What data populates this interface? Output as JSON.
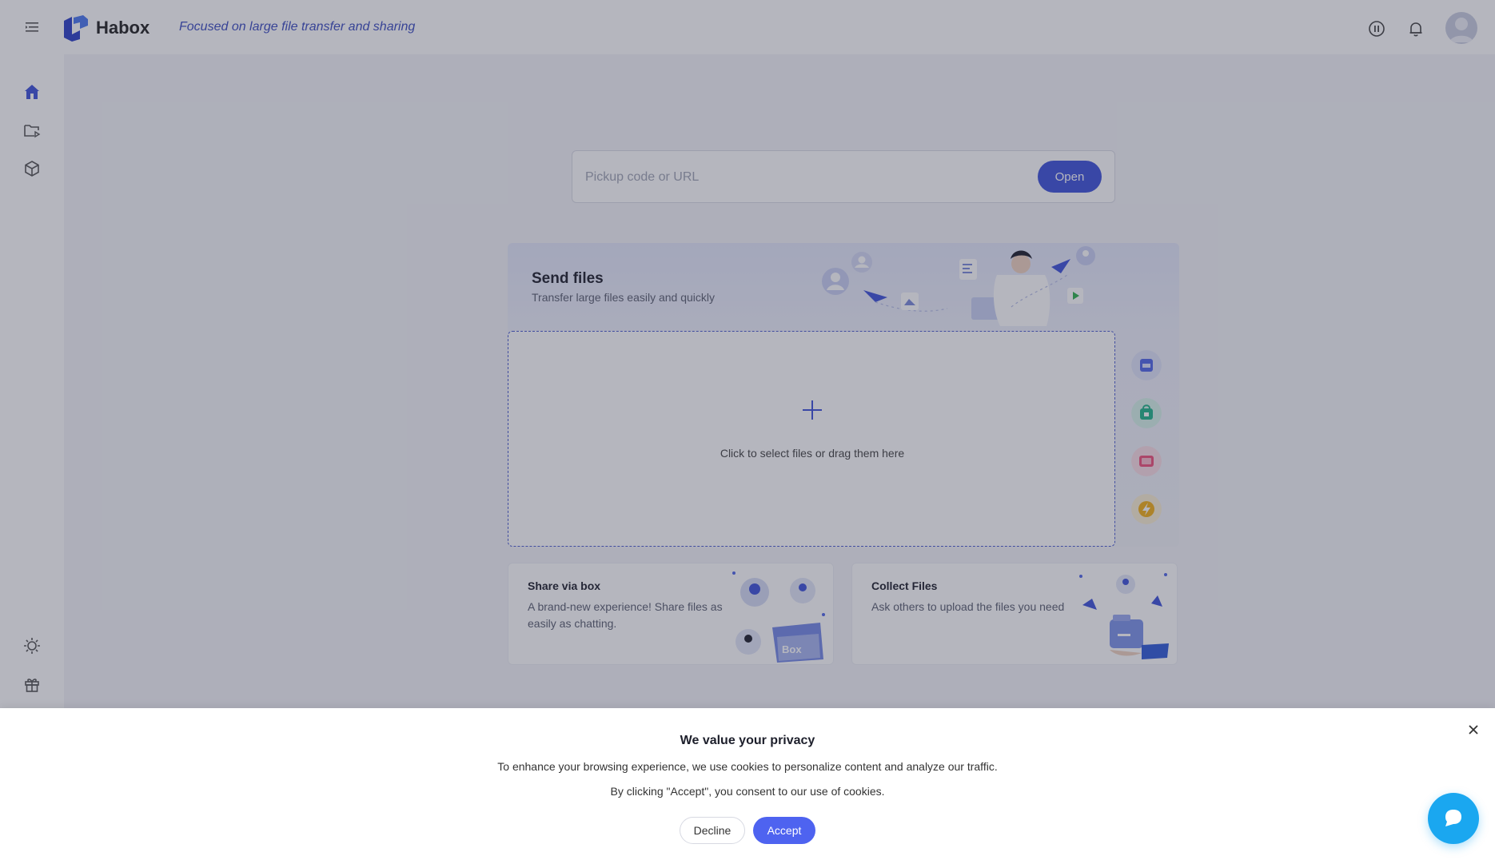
{
  "header": {
    "brand": "Habox",
    "tagline": "Focused on large file transfer and sharing",
    "icons": [
      "menu-icon",
      "logo-icon",
      "premium-badge-icon",
      "bell-icon",
      "avatar"
    ]
  },
  "sidebar": {
    "top_items": [
      "home-icon",
      "folder-share-icon",
      "box-icon"
    ],
    "bottom_items": [
      "theme-toggle-icon",
      "gift-icon"
    ]
  },
  "search": {
    "placeholder": "Pickup code or URL",
    "value": "",
    "button_label": "Open"
  },
  "send": {
    "title": "Send files",
    "subtitle": "Transfer large files easily and quickly",
    "drop_text": "Click to select files or drag them here",
    "features": [
      "5g-icon",
      "security-icon",
      "preview-icon",
      "speed-icon"
    ]
  },
  "share_box": {
    "title": "Share via box",
    "description": "A brand-new experience! Share files as easily as chatting.",
    "illus_label": "Box"
  },
  "collect": {
    "title": "Collect Files",
    "description": "Ask others to upload the files you need"
  },
  "cookie": {
    "title": "We value your privacy",
    "line1": "To enhance your browsing experience, we use cookies to personalize content and analyze our traffic.",
    "line2": "By clicking \"Accept\", you consent to our use of cookies.",
    "decline": "Decline",
    "accept": "Accept"
  },
  "colors": {
    "accent": "#3e52d9",
    "accept": "#4e63f0",
    "chat": "#1aa7f0"
  }
}
